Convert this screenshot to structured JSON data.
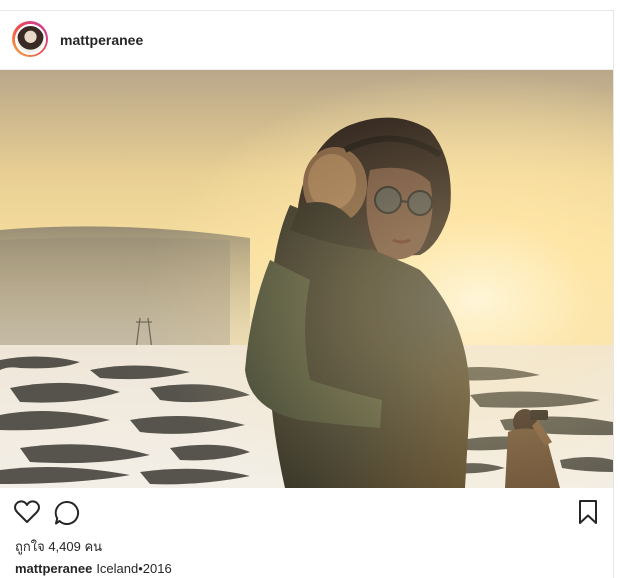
{
  "post": {
    "username": "mattperanee",
    "likes_text": "ถูกใจ 4,409 คน",
    "caption_user": "mattperanee",
    "caption_text": "Iceland•2016"
  },
  "icons": {
    "like": "heart-icon",
    "comment": "comment-bubble-icon",
    "save": "bookmark-icon"
  },
  "colors": {
    "text": "#262626",
    "avatar_ring_start": "#f5b342",
    "avatar_ring_mid": "#ee4a52",
    "avatar_ring_end": "#c33aa8"
  }
}
